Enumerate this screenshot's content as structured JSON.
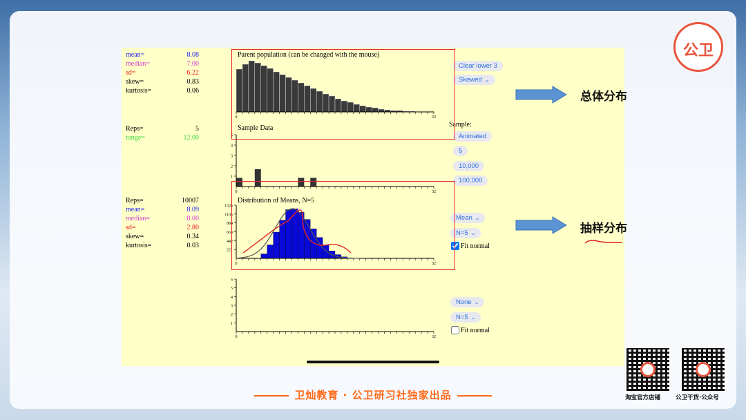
{
  "parent_stats": [
    {
      "key": "mean=",
      "value": "8.08",
      "color": "#1d1df0"
    },
    {
      "key": "median=",
      "value": "7.00",
      "color": "#d13bd1"
    },
    {
      "key": "sd=",
      "value": "6.22",
      "color": "#e21b1b"
    },
    {
      "key": "skew=",
      "value": "0.83",
      "color": "#000000"
    },
    {
      "key": "kurtosis=",
      "value": "0.06",
      "color": "#000000"
    }
  ],
  "sample_stats": [
    {
      "key": "Reps=",
      "value": "5",
      "color": "#000000"
    },
    {
      "key": "range=",
      "value": "12.00",
      "color": "#3fd93f"
    }
  ],
  "means_stats": [
    {
      "key": "Reps=",
      "value": "10007",
      "color": "#000000"
    },
    {
      "key": "mean=",
      "value": "8.09",
      "color": "#1d1df0"
    },
    {
      "key": "median=",
      "value": "8.00",
      "color": "#d13bd1"
    },
    {
      "key": "sd=",
      "value": "2.80",
      "color": "#e21b1b"
    },
    {
      "key": "skew=",
      "value": "0.34",
      "color": "#000000"
    },
    {
      "key": "kurtosis=",
      "value": "0.03",
      "color": "#000000"
    }
  ],
  "panels": {
    "parent_title": "Parent population (can be changed with the mouse)",
    "sample_title": "Sample Data",
    "means_title": "Distribution of Means, N=5"
  },
  "controls": {
    "clear_lower": "Clear lower 3",
    "shape_select": "Skewed",
    "sample_label": "Sample:",
    "animated": "Animated",
    "five": "5",
    "ten_thousand": "10,000",
    "hundred_thousand": "100,000",
    "stat_select_1": "Mean",
    "n_select_1": "N=5",
    "fit_normal_1": "Fit normal",
    "fit_normal_1_checked": true,
    "stat_select_2": "None",
    "n_select_2": "N=5",
    "fit_normal_2": "Fit normal",
    "fit_normal_2_checked": false
  },
  "annotations": {
    "population_label": "总体分布",
    "sampling_label": "抽样分布"
  },
  "footer": {
    "text": "卫灿教育 · 公卫研习社独家出品",
    "qr1_label": "淘宝官方店铺",
    "qr2_label": "公卫干货·公众号"
  },
  "logo_text": "公卫",
  "axis": {
    "x_start": "0",
    "x_end": "32",
    "sample_y_ticks": [
      "5",
      "4",
      "3",
      "2",
      "1"
    ],
    "means_y_ticks": [
      "1326",
      "1105",
      "884",
      "663",
      "442",
      "221"
    ],
    "empty_y_ticks": [
      "6",
      "5",
      "4",
      "3",
      "2",
      "1"
    ]
  },
  "chart_data": [
    {
      "type": "bar",
      "name": "parent",
      "x": [
        0,
        1,
        2,
        3,
        4,
        5,
        6,
        7,
        8,
        9,
        10,
        11,
        12,
        13,
        14,
        15,
        16,
        17,
        18,
        19,
        20,
        21,
        22,
        23,
        24,
        25,
        26,
        27,
        28,
        29,
        30,
        31
      ],
      "values": [
        62,
        69,
        74,
        71,
        67,
        63,
        58,
        54,
        50,
        46,
        42,
        38,
        34,
        30,
        26,
        23,
        19,
        16,
        14,
        11,
        9,
        7,
        6,
        4,
        3,
        2,
        2,
        1,
        1,
        0,
        0,
        0
      ],
      "xlim": [
        0,
        32
      ]
    },
    {
      "type": "bar",
      "name": "sample",
      "x": [
        0,
        1,
        2,
        3,
        4,
        5,
        6,
        7,
        8,
        9,
        10,
        11,
        12,
        13,
        14,
        15,
        16,
        17,
        18,
        19,
        20,
        21,
        22,
        23,
        24,
        25,
        26,
        27,
        28,
        29,
        30,
        31
      ],
      "values": [
        1,
        0,
        0,
        0,
        0,
        0,
        0,
        0,
        0,
        0,
        0,
        0,
        0,
        0,
        0,
        0,
        0,
        0,
        0,
        0,
        0,
        0,
        0,
        0,
        0,
        0,
        0,
        0,
        0,
        0,
        0,
        0
      ],
      "extra": {
        "bars": [
          [
            0,
            1
          ],
          [
            3,
            2
          ],
          [
            10,
            1
          ],
          [
            12,
            1
          ]
        ]
      },
      "ylim": [
        0,
        5
      ],
      "xlim": [
        0,
        32
      ]
    },
    {
      "type": "bar",
      "name": "means",
      "x": [
        0,
        1,
        2,
        3,
        4,
        5,
        6,
        7,
        8,
        9,
        10,
        11,
        12,
        13,
        14,
        15,
        16,
        17,
        18,
        19,
        20
      ],
      "values": [
        0,
        0,
        0,
        5,
        120,
        360,
        700,
        1020,
        1300,
        1326,
        1230,
        1040,
        790,
        560,
        360,
        200,
        100,
        40,
        12,
        3,
        0
      ],
      "ylim": [
        0,
        1420
      ],
      "xlim": [
        0,
        32
      ]
    }
  ],
  "colors": {
    "parent_bar": "#3a3a3a",
    "sample_bar": "#333333",
    "means_bar": "#0a0ad8",
    "accent_red": "#e0262b",
    "footer_orange": "#ff6a1a"
  }
}
